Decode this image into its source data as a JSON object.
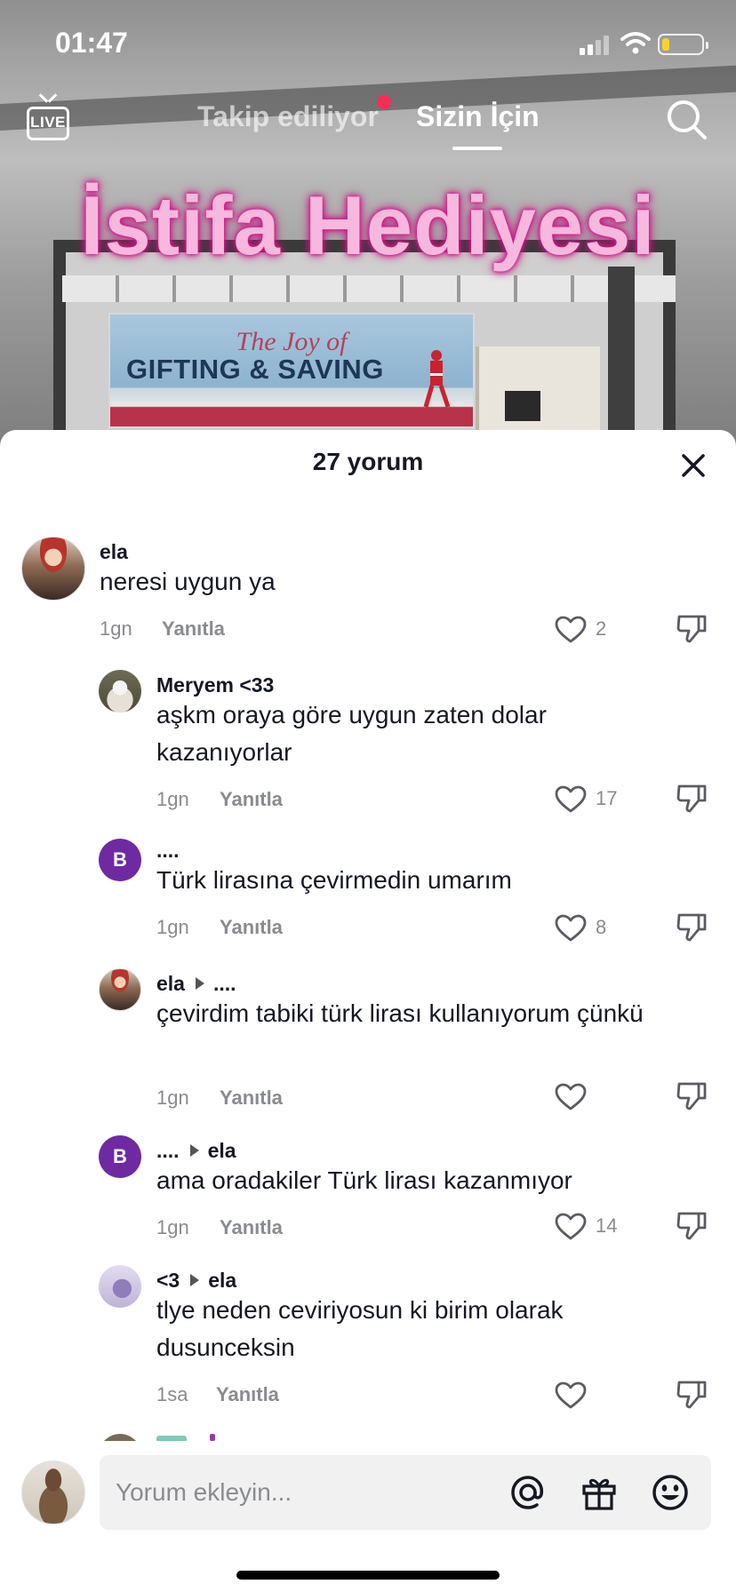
{
  "status_bar": {
    "time": "01:47",
    "signal_bars_active": 2,
    "battery_level": 0.2,
    "colors": {
      "battery_low": "#f5d130"
    }
  },
  "top_nav": {
    "live_label": "LIVE",
    "tabs": [
      {
        "label": "Takip ediliyor",
        "active": false,
        "has_notification_dot": true
      },
      {
        "label": "Sizin İçin",
        "active": true
      }
    ],
    "search_icon": "search-icon"
  },
  "video": {
    "overlay_text": "İstifa Hediyesi",
    "sign_line1": "The Joy of",
    "sign_line2": "GIFTING & SAVING",
    "overlay_color": "#f7b8de",
    "glow_color": "#d8178c"
  },
  "comments_panel": {
    "title": "27 yorum",
    "close_icon": "close-icon",
    "comments": [
      {
        "username": "ela",
        "text": "neresi uygun ya",
        "time": "1gn",
        "reply_label": "Yanıtla",
        "likes": "2"
      },
      {
        "username": "Meryem <33",
        "text": "aşkm oraya göre uygun zaten dolar kazanıyorlar",
        "time": "1gn",
        "reply_label": "Yanıtla",
        "likes": "17"
      },
      {
        "username": "....",
        "avatar_letter": "B",
        "text": "Türk lirasına çevirmedin umarım",
        "time": "1gn",
        "reply_label": "Yanıtla",
        "likes": "8"
      },
      {
        "username": "ela",
        "reply_to": "....",
        "text": "çevirdim tabiki türk lirası kullanıyorum çünkü",
        "time": "1gn",
        "reply_label": "Yanıtla",
        "likes": ""
      },
      {
        "username": "....",
        "avatar_letter": "B",
        "reply_to": "ela",
        "text": "ama oradakiler Türk lirası kazanmıyor",
        "time": "1gn",
        "reply_label": "Yanıtla",
        "likes": "14"
      },
      {
        "username": "<3",
        "reply_to": "ela",
        "text": "tlye neden ceviriyosun ki birim olarak dusunceksin",
        "time": "1sa",
        "reply_label": "Yanıtla",
        "likes": ""
      }
    ]
  },
  "input_bar": {
    "placeholder": "Yorum ekleyin...",
    "icons": [
      "mention-icon",
      "gift-icon",
      "emoji-icon"
    ]
  }
}
